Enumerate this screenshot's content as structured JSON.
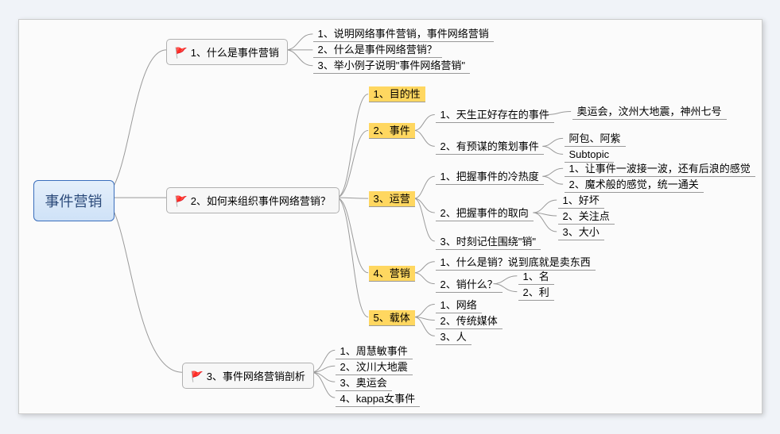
{
  "root": {
    "label": "事件营销"
  },
  "mains": [
    {
      "flag": "🚩",
      "flagColor": "#2b5fd6",
      "label": "1、什么是事件营销"
    },
    {
      "flag": "🚩",
      "flagColor": "#8936c7",
      "label": "2、如何来组织事件网络营销？"
    },
    {
      "flag": "🚩",
      "flagColor": "#d22c2c",
      "label": "3、事件网络营销剖析"
    }
  ],
  "m1": [
    "1、说明网络事件营销，事件网络营销",
    "2、什么是事件网络营销？",
    "3、举小例子说明\"事件网络营销\""
  ],
  "m2sub": [
    "1、目的性",
    "2、事件",
    "3、运营",
    "4、营销",
    "5、载体"
  ],
  "event_children": [
    "1、天生正好存在的事件",
    "2、有预谋的策划事件"
  ],
  "event_c1_leaf": "奥运会，汶州大地震，神州七号",
  "event_c2_leaves": [
    "阿包、阿紫",
    "Subtopic"
  ],
  "op_children": [
    "1、把握事件的冷热度",
    "2、把握事件的取向",
    "3、时刻记住围绕\"销\""
  ],
  "op_c1_leaves": [
    "1、让事件一波接一波，还有后浪的感觉",
    "2、魔术般的感觉，统一通关"
  ],
  "op_c2_leaves": [
    "1、好坏",
    "2、关注点",
    "3、大小"
  ],
  "mkt_children": [
    "1、什么是销？说到底就是卖东西",
    "2、销什么？"
  ],
  "mkt_c2_leaves": [
    "1、名",
    "2、利"
  ],
  "carrier_children": [
    "1、网络",
    "2、传统媒体",
    "3、人"
  ],
  "m3": [
    "1、周慧敏事件",
    "2、汶川大地震",
    "3、奥运会",
    "4、kappa女事件"
  ]
}
